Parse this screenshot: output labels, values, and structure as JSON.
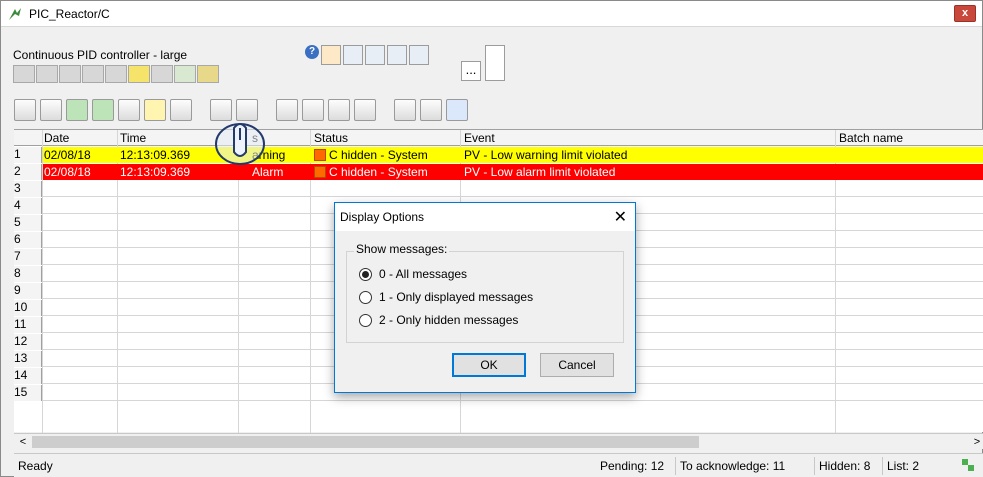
{
  "window": {
    "title": "PIC_Reactor/C",
    "close_glyph": "x"
  },
  "faceplate": {
    "label": "Continuous PID controller - large",
    "help_glyph": "?",
    "more_glyph": "..."
  },
  "grid": {
    "columns": [
      "Date",
      "Time",
      "s",
      "Status",
      "Event",
      "Batch name"
    ],
    "rows": [
      {
        "n": "1",
        "date": "02/08/18",
        "time": "12:13:09.369",
        "state": "arning",
        "status": "C hidden - System",
        "event": "PV - Low warning limit violated",
        "batch": "",
        "color": "#ffff00"
      },
      {
        "n": "2",
        "date": "02/08/18",
        "time": "12:13:09.369",
        "state": "Alarm",
        "status": "C hidden - System",
        "event": "PV - Low alarm limit violated",
        "batch": "",
        "color": "#ff0000"
      },
      {
        "n": "3"
      },
      {
        "n": "4"
      },
      {
        "n": "5"
      },
      {
        "n": "6"
      },
      {
        "n": "7"
      },
      {
        "n": "8"
      },
      {
        "n": "9"
      },
      {
        "n": "10"
      },
      {
        "n": "11"
      },
      {
        "n": "12"
      },
      {
        "n": "13"
      },
      {
        "n": "14"
      },
      {
        "n": "15"
      }
    ]
  },
  "scrollbar": {
    "left_glyph": "<",
    "right_glyph": ">"
  },
  "statusbar": {
    "ready": "Ready",
    "pending": "Pending: 12",
    "to_ack": "To acknowledge: 11",
    "hidden": "Hidden: 8",
    "list": "List: 2"
  },
  "dialog": {
    "title": "Display Options",
    "close": "✕",
    "group_label": "Show messages:",
    "options": [
      "0 - All messages",
      "1 - Only displayed messages",
      "2 - Only hidden messages"
    ],
    "ok": "OK",
    "cancel": "Cancel"
  }
}
